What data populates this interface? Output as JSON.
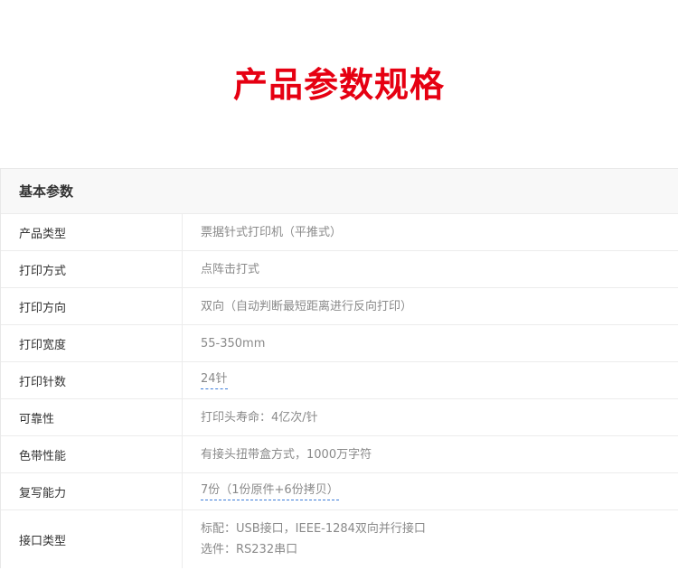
{
  "page": {
    "title": "产品参数规格"
  },
  "section": {
    "title": "基本参数"
  },
  "specs": [
    {
      "label": "产品类型",
      "value": "票据针式打印机（平推式）"
    },
    {
      "label": "打印方式",
      "value": "点阵击打式"
    },
    {
      "label": "打印方向",
      "value": "双向（自动判断最短距离进行反向打印）"
    },
    {
      "label": "打印宽度",
      "value": "55-350mm"
    },
    {
      "label": "打印针数",
      "value": "24针"
    },
    {
      "label": "可靠性",
      "value": "打印头寿命：4亿次/针"
    },
    {
      "label": "色带性能",
      "value": "有接头扭带盒方式，1000万字符"
    },
    {
      "label": "复写能力",
      "value": "7份（1份原件+6份拷贝）"
    },
    {
      "label": "接口类型",
      "value_line1": "标配：USB接口，IEEE-1284双向并行接口",
      "value_line2": "选件：RS232串口"
    }
  ]
}
